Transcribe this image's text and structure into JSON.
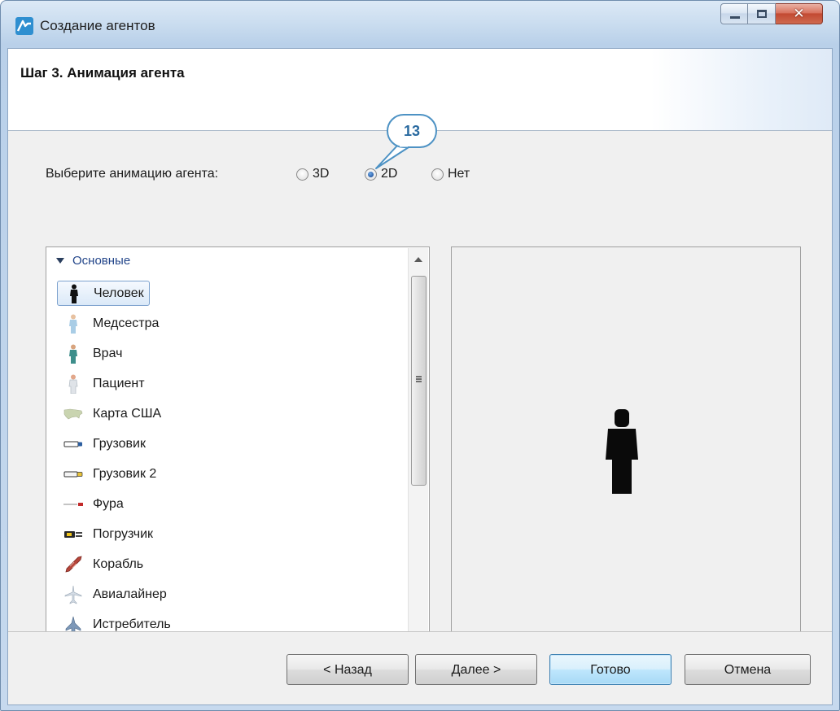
{
  "window": {
    "title": "Создание агентов",
    "close_glyph": "✕"
  },
  "header": {
    "step_title": "Шаг 3. Анимация агента"
  },
  "animation": {
    "label": "Выберите анимацию агента:",
    "options": [
      {
        "label": "3D",
        "selected": false
      },
      {
        "label": "2D",
        "selected": true
      },
      {
        "label": "Нет",
        "selected": false
      }
    ]
  },
  "callout": {
    "number": "13"
  },
  "tree": {
    "category": "Основные",
    "items": [
      {
        "label": "Человек",
        "icon": "person-icon",
        "selected": true
      },
      {
        "label": "Медсестра",
        "icon": "nurse-icon",
        "selected": false
      },
      {
        "label": "Врач",
        "icon": "doctor-icon",
        "selected": false
      },
      {
        "label": "Пациент",
        "icon": "patient-icon",
        "selected": false
      },
      {
        "label": "Карта США",
        "icon": "usa-map-icon",
        "selected": false
      },
      {
        "label": "Грузовик",
        "icon": "truck-icon",
        "selected": false
      },
      {
        "label": "Грузовик 2",
        "icon": "truck-2-icon",
        "selected": false
      },
      {
        "label": "Фура",
        "icon": "semi-truck-icon",
        "selected": false
      },
      {
        "label": "Погрузчик",
        "icon": "forklift-icon",
        "selected": false
      },
      {
        "label": "Корабль",
        "icon": "ship-icon",
        "selected": false
      },
      {
        "label": "Авиалайнер",
        "icon": "airliner-icon",
        "selected": false
      },
      {
        "label": "Истребитель",
        "icon": "fighter-jet-icon",
        "selected": false
      }
    ]
  },
  "preview": {
    "icon": "person-silhouette-icon"
  },
  "footer": {
    "back_label": "< Назад",
    "next_label": "Далее >",
    "finish_label": "Готово",
    "cancel_label": "Отмена"
  }
}
